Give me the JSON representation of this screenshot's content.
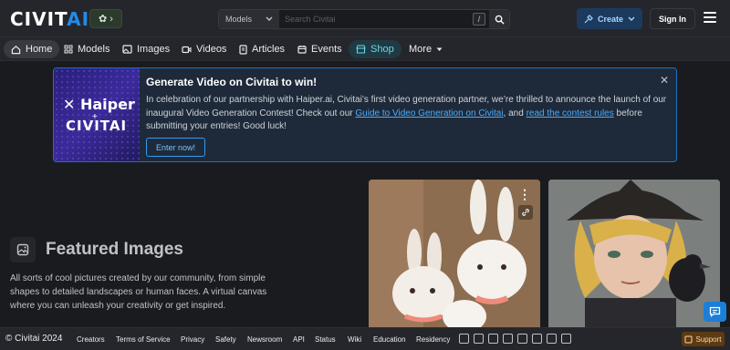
{
  "header": {
    "logo_text": "CIVIT",
    "logo_accent": "AI",
    "search_type": "Models",
    "search_placeholder": "Search Civitai",
    "search_shortcut": "/",
    "create_label": "Create",
    "signin_label": "Sign In"
  },
  "nav": {
    "items": [
      {
        "label": "Home",
        "icon": "home-icon"
      },
      {
        "label": "Models",
        "icon": "grid-icon"
      },
      {
        "label": "Images",
        "icon": "image-icon"
      },
      {
        "label": "Videos",
        "icon": "video-icon"
      },
      {
        "label": "Articles",
        "icon": "article-icon"
      },
      {
        "label": "Events",
        "icon": "calendar-icon"
      },
      {
        "label": "Shop",
        "icon": "shop-icon"
      },
      {
        "label": "More",
        "icon": "caret-down-icon"
      }
    ]
  },
  "banner": {
    "image_title": "Haiper",
    "image_plus": "+",
    "image_subtitle": "CIVITAI",
    "title": "Generate Video on Civitai to win!",
    "text_1": "In celebration of our partnership with Haiper.ai, Civitai’s first video generation partner, we’re thrilled to announce the launch of our inaugural Video Generation Contest! Check out our ",
    "link_1": "Guide to Video Generation on Civitai",
    "text_2": ", and ",
    "link_2": "read the contest rules",
    "text_3": " before submitting your entries! Good luck!",
    "button_label": "Enter now!"
  },
  "featured": {
    "title": "Featured Images",
    "description": "All sorts of cool pictures created by our community, from simple shapes to detailed landscapes or human faces. A virtual canvas where you can unleash your creativity or get inspired."
  },
  "footer": {
    "copyright": "© Civitai 2024",
    "links": [
      "Creators",
      "Terms of Service",
      "Privacy",
      "Safety",
      "Newsroom",
      "API",
      "Status",
      "Wiki",
      "Education",
      "Residency"
    ],
    "support_label": "Support"
  },
  "colors": {
    "accent": "#228be6",
    "background": "#1a1b1e",
    "surface": "#25262b",
    "shop": "#66d9e8"
  }
}
